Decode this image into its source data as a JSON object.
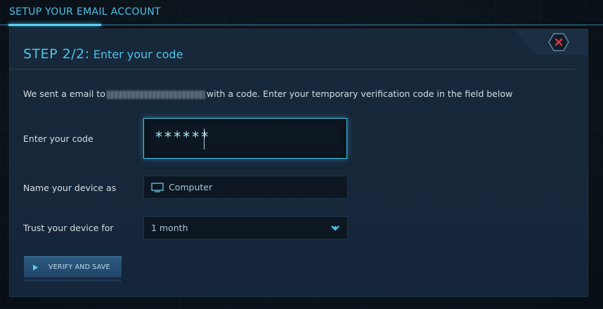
{
  "header": {
    "title": "SETUP YOUR EMAIL ACCOUNT"
  },
  "step": {
    "number": "STEP 2/2:",
    "subtitle": "Enter your code"
  },
  "description": {
    "before": "We sent a email to",
    "after": "with a code. Enter your temporary verification code in the field below"
  },
  "code": {
    "label": "Enter your code",
    "value": "******"
  },
  "device": {
    "label": "Name your device as",
    "value": "Computer",
    "icon": "monitor-icon"
  },
  "trust": {
    "label": "Trust your device for",
    "value": "1 month",
    "icon": "chevron-down-icon"
  },
  "verify": {
    "label": "VERIFY AND SAVE",
    "icon": "play-icon"
  },
  "close": {
    "icon": "close-icon"
  },
  "colors": {
    "accent": "#4fc3e8",
    "panel": "#17283a",
    "close_red": "#d9333b"
  }
}
